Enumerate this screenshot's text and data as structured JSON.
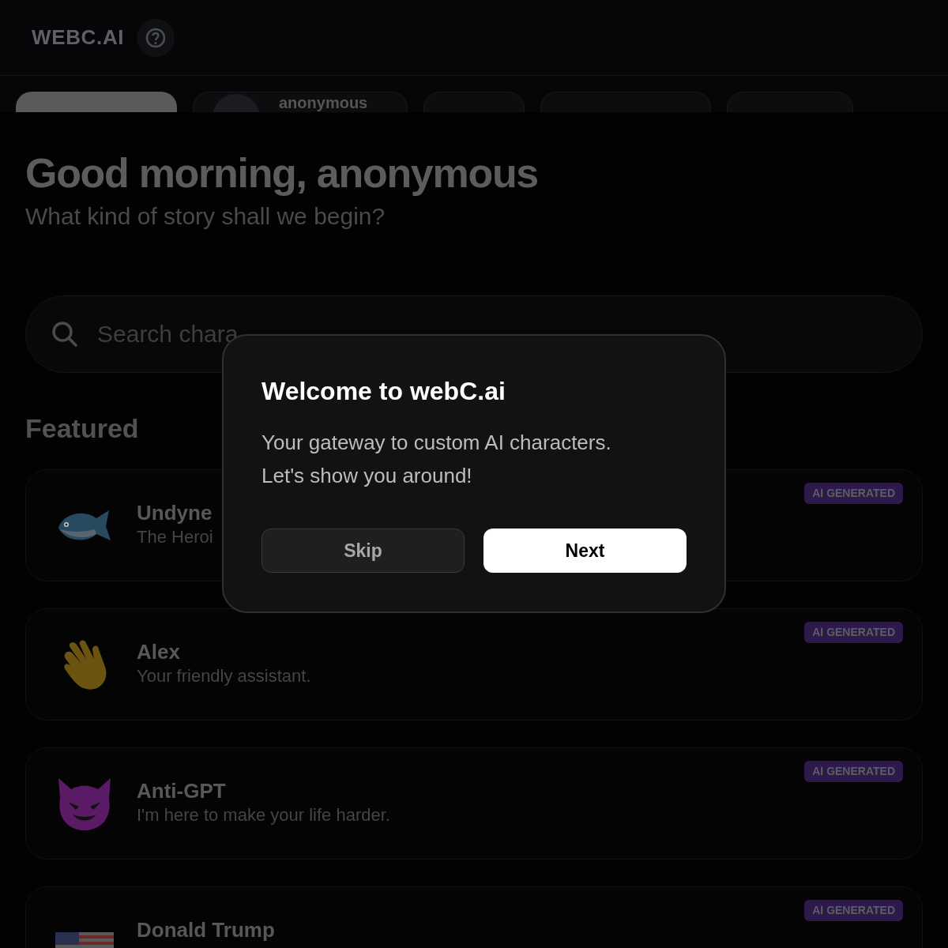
{
  "header": {
    "logo": "WEBC.AI"
  },
  "tabs": [
    {
      "selected": true
    },
    {
      "label": "anonymous",
      "selected": false,
      "avatar": true
    },
    {
      "selected": false
    },
    {
      "selected": false
    },
    {
      "selected": false
    }
  ],
  "greeting": {
    "title": "Good morning, anonymous",
    "subtitle": "What kind of story shall we begin?"
  },
  "search": {
    "placeholder": "Search chara"
  },
  "section_title": "Featured",
  "characters": [
    {
      "name": "Undyne",
      "description": "The Heroi",
      "badge": "AI GENERATED"
    },
    {
      "name": "Alex",
      "description": "Your friendly assistant.",
      "badge": "AI GENERATED"
    },
    {
      "name": "Anti-GPT",
      "description": "I'm here to make your life harder.",
      "badge": "AI GENERATED"
    },
    {
      "name": "Donald Trump",
      "badge": "AI GENERATED"
    }
  ],
  "dialog": {
    "title": "Welcome to webC.ai",
    "body": [
      "Your gateway to custom AI characters.",
      "Let's show you around!"
    ],
    "buttons": [
      {
        "label": "Skip",
        "kind": "secondary"
      },
      {
        "label": "Next",
        "kind": "primary"
      }
    ]
  }
}
